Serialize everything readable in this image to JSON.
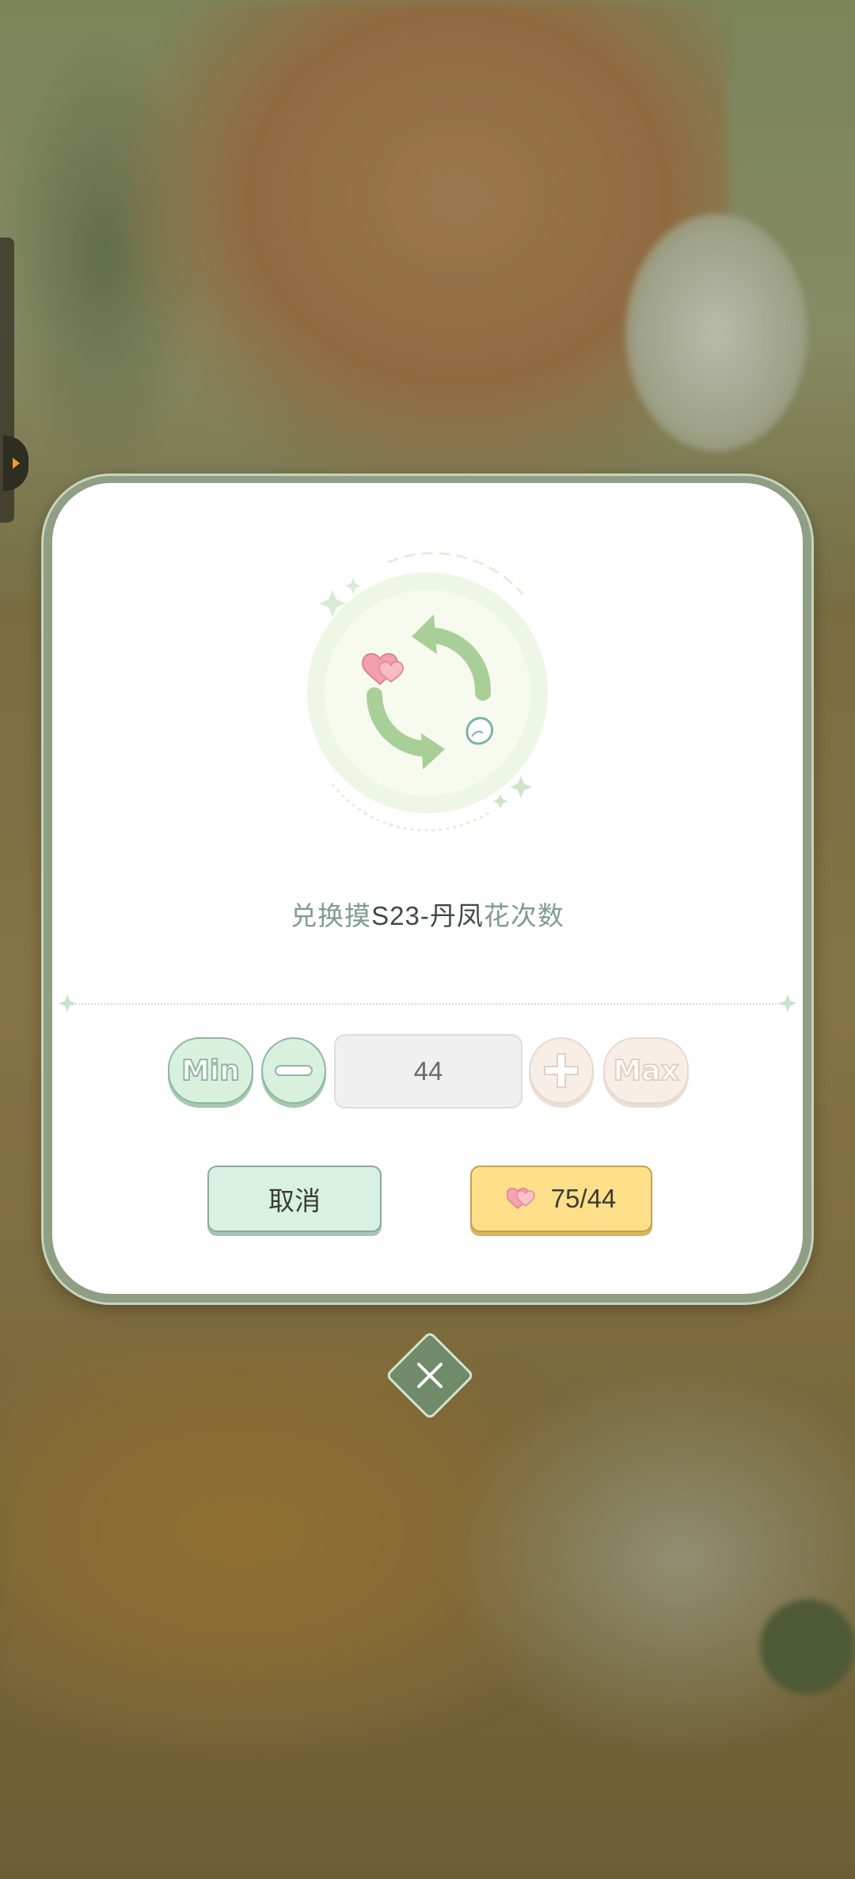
{
  "dialog": {
    "title_prefix": "兑换摸",
    "title_item": "S23-丹凤",
    "title_suffix": "花次数"
  },
  "stepper": {
    "min_label": "Min",
    "max_label": "Max",
    "quantity": "44"
  },
  "actions": {
    "cancel_label": "取消",
    "confirm_label": "75/44"
  },
  "icons": {
    "side_tab": "chevron-right-icon",
    "exchange": "exchange-cycle-icon",
    "minus": "minus-icon",
    "plus": "plus-icon",
    "currency": "heart-icon",
    "close": "close-icon"
  },
  "colors": {
    "accent_green": "#8fb79e",
    "confirm_yellow": "#ffe08a",
    "cancel_mint": "#d7f1e2",
    "close_green": "#6f8b6a"
  }
}
